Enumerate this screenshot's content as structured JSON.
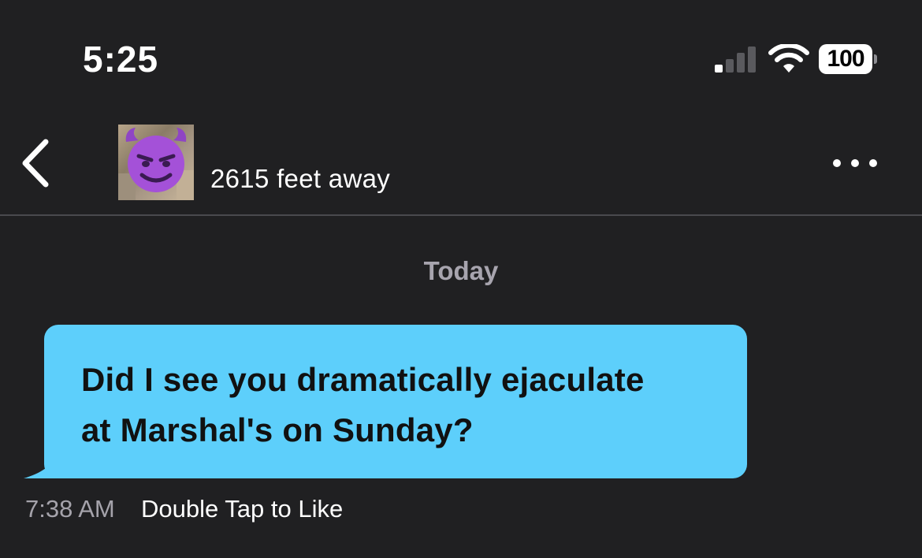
{
  "status_bar": {
    "time": "5:25",
    "signal_icon": "cellular-signal-icon",
    "wifi_icon": "wifi-icon",
    "battery_level": "100"
  },
  "header": {
    "back_icon": "chevron-left-icon",
    "avatar_emoji": "smiling-face-with-horns",
    "distance": "2615 feet away",
    "more_icon": "ellipsis-icon"
  },
  "conversation": {
    "date_separator": "Today",
    "messages": [
      {
        "text_line_1": "Did I see you dramatically ejaculate",
        "text_line_2": "at Marshal's on Sunday?",
        "time": "7:38 AM",
        "hint": "Double Tap to Like",
        "bubble_color": "#5dcffb"
      }
    ]
  },
  "colors": {
    "background": "#202022",
    "bubble": "#5dcffb",
    "muted_text": "#a7a4ae"
  }
}
